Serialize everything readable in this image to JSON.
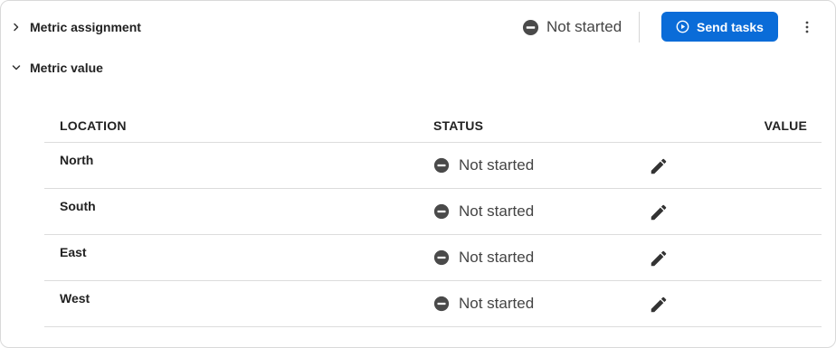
{
  "sections": {
    "assignment": {
      "title": "Metric assignment",
      "expanded": false,
      "status": "Not started",
      "send_label": "Send tasks"
    },
    "value": {
      "title": "Metric value",
      "expanded": true
    }
  },
  "table": {
    "headers": {
      "location": "LOCATION",
      "status": "STATUS",
      "value": "VALUE"
    },
    "rows": [
      {
        "location": "North",
        "status": "Not started",
        "value": ""
      },
      {
        "location": "South",
        "status": "Not started",
        "value": ""
      },
      {
        "location": "East",
        "status": "Not started",
        "value": ""
      },
      {
        "location": "West",
        "status": "Not started",
        "value": ""
      }
    ]
  },
  "colors": {
    "accent": "#0a6cd8",
    "status_icon": "#4a4a4a",
    "divider": "#dcdcdc"
  },
  "icons": {
    "collapsed": "chevron-right-icon",
    "expanded": "chevron-down-icon",
    "status": "minus-circle-icon",
    "send": "play-circle-icon",
    "more": "kebab-menu-icon",
    "edit": "pencil-icon"
  }
}
